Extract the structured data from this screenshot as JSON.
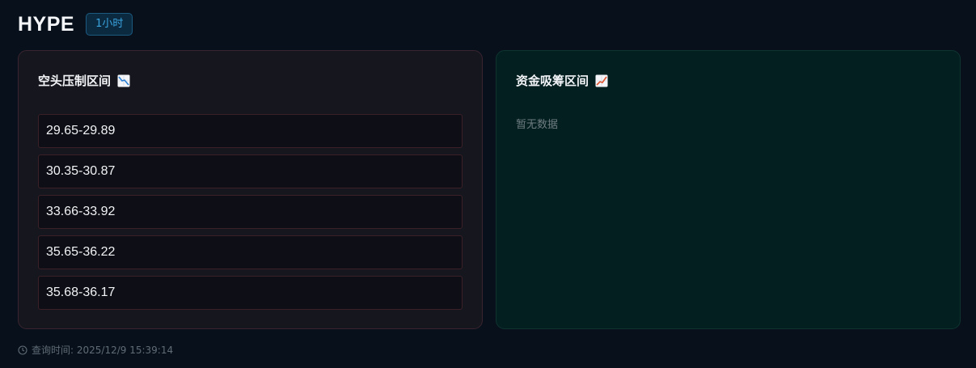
{
  "header": {
    "symbol": "HYPE",
    "timeframe": "1小时"
  },
  "short_panel": {
    "title": "空头压制区间",
    "icon": "chart-decreasing-icon",
    "zones": [
      "29.65-29.89",
      "30.35-30.87",
      "33.66-33.92",
      "35.65-36.22",
      "35.68-36.17"
    ]
  },
  "accumulation_panel": {
    "title": "资金吸筹区间",
    "icon": "chart-increasing-icon",
    "empty_text": "暂无数据"
  },
  "footer": {
    "icon": "clock-icon",
    "query_time_label": "查询时间: 2025/12/9 15:39:14"
  },
  "colors": {
    "background": "#08111b",
    "short_panel_bg": "#16161e",
    "short_border": "#3a2430",
    "accum_panel_bg": "#031f20",
    "badge_text": "#3ba5e0"
  }
}
